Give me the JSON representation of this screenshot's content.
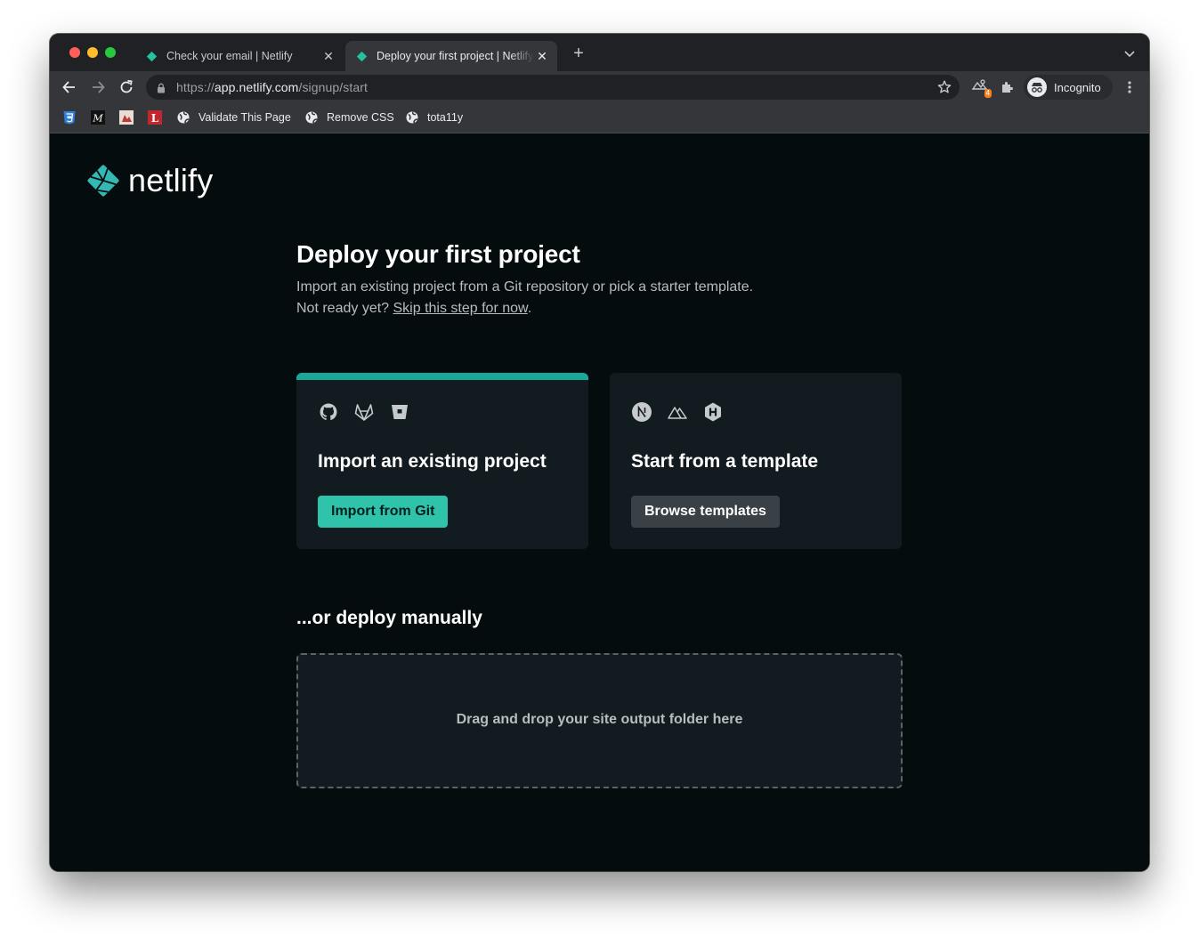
{
  "browser": {
    "tabs": [
      {
        "title": "Check your email | Netlify",
        "active": false
      },
      {
        "title": "Deploy your first project | Netlify",
        "active": true
      }
    ],
    "url": {
      "scheme": "https://",
      "host": "app.netlify.com",
      "path": "/signup/start"
    },
    "extension_badge": "4",
    "profile_label": "Incognito",
    "bookmarks": [
      {
        "label": "",
        "icon": "css-icon"
      },
      {
        "label": "",
        "icon": "m-icon"
      },
      {
        "label": "",
        "icon": "image-icon"
      },
      {
        "label": "",
        "icon": "l-icon"
      },
      {
        "label": "Validate This Page",
        "icon": "globe-icon"
      },
      {
        "label": "Remove CSS",
        "icon": "globe-icon"
      },
      {
        "label": "tota11y",
        "icon": "globe-icon"
      }
    ]
  },
  "page": {
    "logo_text": "netlify",
    "title": "Deploy your first project",
    "subtitle_line1": "Import an existing project from a Git repository or pick a starter template.",
    "subtitle_line2_prefix": "Not ready yet? ",
    "skip_link": "Skip this step for now",
    "subtitle_line2_suffix": ".",
    "cards": [
      {
        "title": "Import an existing project",
        "button": "Import from Git",
        "icons": [
          "github-icon",
          "gitlab-icon",
          "bitbucket-icon"
        ]
      },
      {
        "title": "Start from a template",
        "button": "Browse templates",
        "icons": [
          "nextjs-icon",
          "nuxt-icon",
          "hugo-icon"
        ]
      }
    ],
    "manual_heading": "...or deploy manually",
    "dropzone_text": "Drag and drop your site output folder here"
  },
  "colors": {
    "page_background": "#040c0e",
    "card_background": "#121b20",
    "accent_teal": "#2fc3ac",
    "secondary_button": "#3a4146"
  }
}
